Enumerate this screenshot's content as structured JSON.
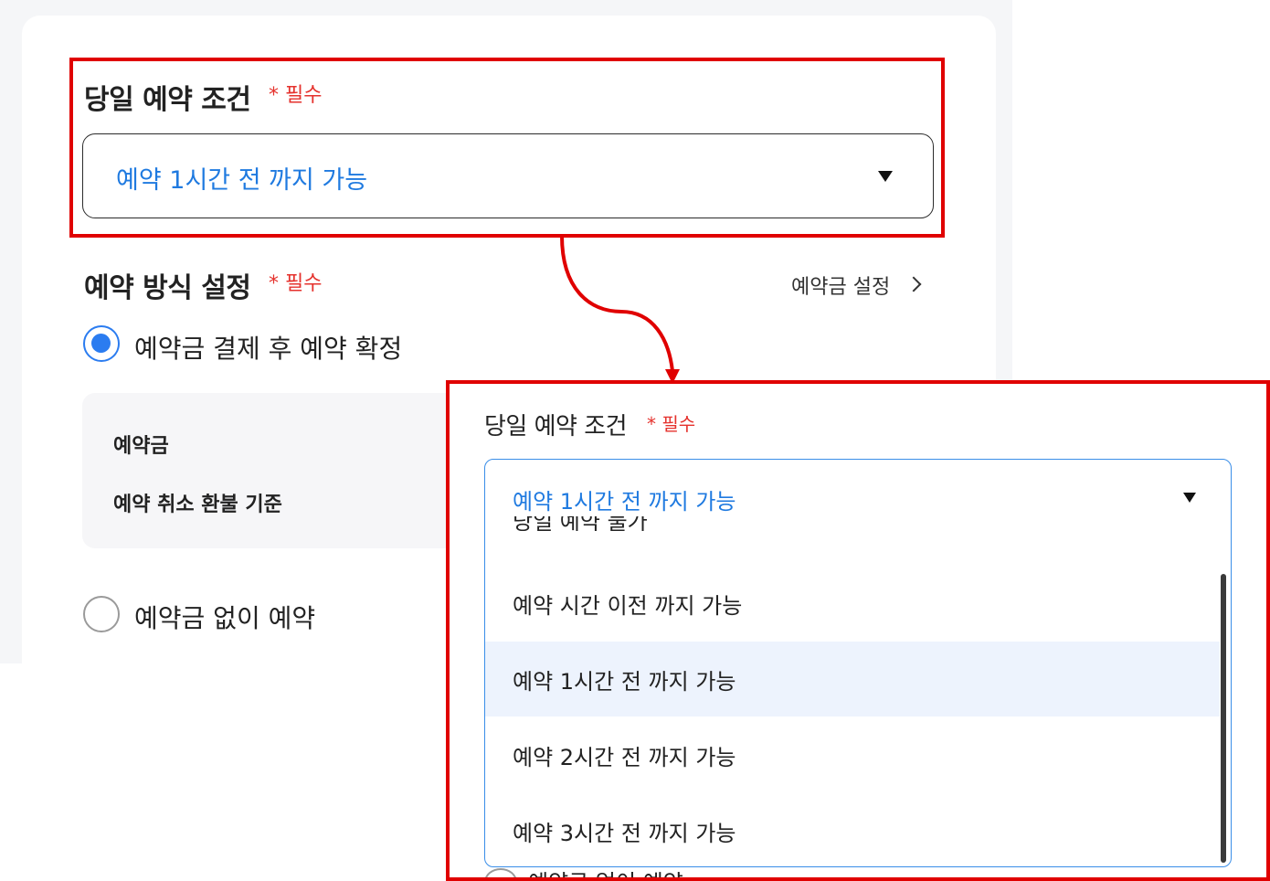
{
  "form": {
    "same_day": {
      "title": "당일 예약 조건",
      "required": "* 필수",
      "selected_value": "예약 1시간 전 까지 가능"
    },
    "method": {
      "title": "예약 방식 설정",
      "required": "* 필수",
      "deposit_link": "예약금 설정",
      "option_with_deposit": "예약금 결제 후 예약 확정",
      "option_without_deposit": "예약금 없이 예약",
      "info": {
        "deposit_label": "예약금",
        "refund_label": "예약 취소 환불 기준"
      }
    }
  },
  "zoom": {
    "title": "당일 예약 조건",
    "required": "* 필수",
    "selected_value": "예약 1시간 전 까지 가능",
    "partial_top": "당일 예약 불가",
    "options": [
      "예약 시간 이전 까지 가능",
      "예약 1시간 전 까지 가능",
      "예약 2시간 전 까지 가능",
      "예약 3시간 전 까지 가능"
    ],
    "partial_bottom": "예약금 없이 예약"
  },
  "colors": {
    "accent": "#1f7ae0",
    "required": "#e5322d",
    "highlight": "#e00000",
    "selected_bg": "#edf3fd"
  }
}
